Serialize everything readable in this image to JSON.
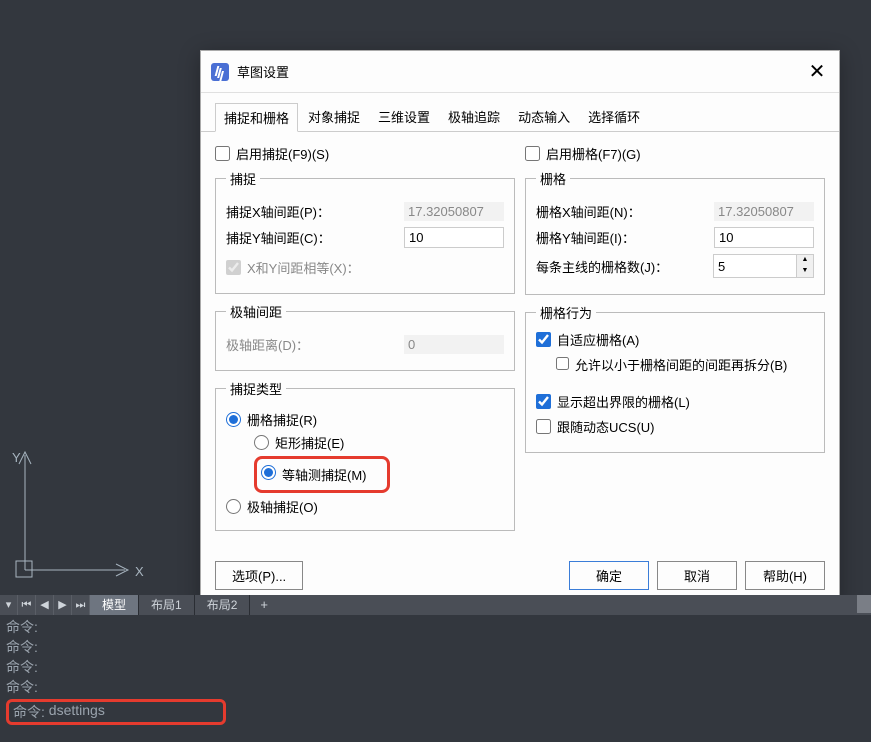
{
  "axis": {
    "y": "Y",
    "x": "X"
  },
  "dialog": {
    "title": "草图设置",
    "tabs": [
      "捕捉和栅格",
      "对象捕捉",
      "三维设置",
      "极轴追踪",
      "动态输入",
      "选择循环"
    ],
    "activeTab": 0,
    "left": {
      "enableSnap": "启用捕捉(F9)(S)",
      "snapGroup": "捕捉",
      "snapX": "捕捉X轴间距(P)：",
      "snapXVal": "17.32050807",
      "snapY": "捕捉Y轴间距(C)：",
      "snapYVal": "10",
      "equalXY": "X和Y间距相等(X)：",
      "polarGroup": "极轴间距",
      "polarDist": "极轴距离(D)：",
      "polarDistVal": "0",
      "typeGroup": "捕捉类型",
      "gridSnap": "栅格捕捉(R)",
      "rectSnap": "矩形捕捉(E)",
      "isoSnap": "等轴测捕捉(M)",
      "polarSnap": "极轴捕捉(O)"
    },
    "right": {
      "enableGrid": "启用栅格(F7)(G)",
      "gridGroup": "栅格",
      "gridX": "栅格X轴间距(N)：",
      "gridXVal": "17.32050807",
      "gridY": "栅格Y轴间距(I)：",
      "gridYVal": "10",
      "majorLines": "每条主线的栅格数(J)：",
      "majorLinesVal": "5",
      "behaviorGroup": "栅格行为",
      "adaptive": "自适应栅格(A)",
      "allowSub": "允许以小于栅格间距的间距再拆分(B)",
      "showBeyond": "显示超出界限的栅格(L)",
      "followUcs": "跟随动态UCS(U)"
    },
    "footer": {
      "options": "选项(P)...",
      "ok": "确定",
      "cancel": "取消",
      "help": "帮助(H)"
    }
  },
  "layoutTabs": {
    "model": "模型",
    "layout1": "布局1",
    "layout2": "布局2",
    "add": "+"
  },
  "command": {
    "prompt": "命令:",
    "typed": "dsettings"
  }
}
